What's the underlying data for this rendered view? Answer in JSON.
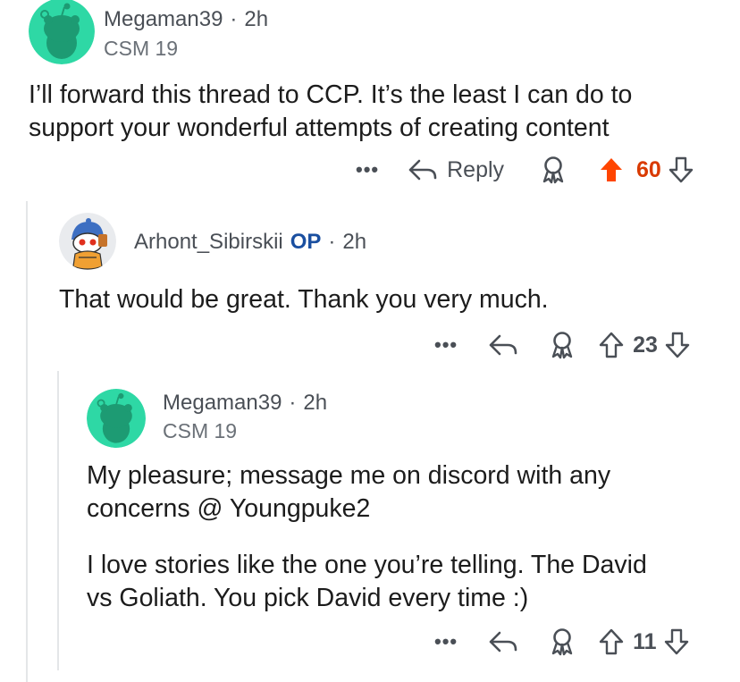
{
  "comments": [
    {
      "username": "Megaman39",
      "separator": "·",
      "time": "2h",
      "flair": "CSM 19",
      "body": [
        "I’ll forward this thread to CCP. It’s the least I can do to",
        "support your wonderful attempts of creating content"
      ],
      "actions": {
        "more": "•••",
        "reply_label": "Reply",
        "score": "60",
        "upvoted": true
      }
    },
    {
      "username": "Arhont_Sibirskii",
      "op_badge": "OP",
      "separator": "·",
      "time": "2h",
      "body": [
        "That would be great. Thank you very much."
      ],
      "actions": {
        "more": "•••",
        "score": "23",
        "upvoted": false
      }
    },
    {
      "username": "Megaman39",
      "separator": "·",
      "time": "2h",
      "flair": "CSM 19",
      "body": [
        "My pleasure; message me on discord with any",
        "concerns @ Youngpuke2"
      ],
      "body2": [
        "I love stories like the one you’re telling. The David",
        "vs Goliath. You pick David every time :)"
      ],
      "actions": {
        "more": "•••",
        "score": "11",
        "upvoted": false
      }
    }
  ],
  "colors": {
    "avatar_bg": "#2ed8a5",
    "upvote_active": "#ff4500",
    "score_active": "#d93a00",
    "muted": "#4a4f56",
    "op_blue": "#1a4fa0"
  },
  "icons": [
    "snoo-avatar-icon",
    "custom-avatar-icon",
    "reply-arrow-icon",
    "award-icon",
    "upvote-icon",
    "downvote-icon",
    "more-icon"
  ]
}
